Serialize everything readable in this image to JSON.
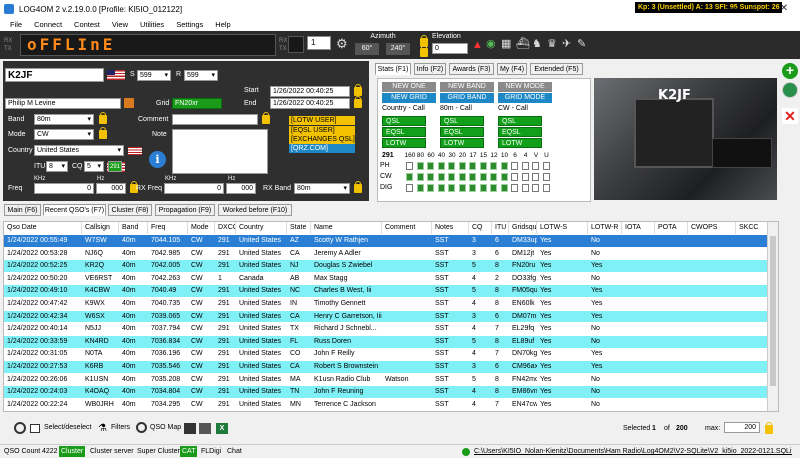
{
  "titlebar": {
    "title": "LOG4OM 2 v.2.19.0.0 [Profile: KI5IO_012122]",
    "kp": "Kp: 3 (Unsettled) A: 13 SFI: 95 Sunspot: 26",
    "min": "—",
    "max": "☐",
    "close": "✕"
  },
  "menu": [
    "File",
    "Connect",
    "Contest",
    "View",
    "Utilities",
    "Settings",
    "Help"
  ],
  "radio": {
    "display": "oFFLInE",
    "rx": "RX",
    "tx": "TX",
    "spin_value": "1",
    "azimuth_label": "Azimuth",
    "az_short": "60°",
    "az_long": "240°",
    "elevation_label": "Elevation",
    "elevation_value": "0"
  },
  "entry": {
    "callsign": "K2JF",
    "rst_s_label": "S",
    "rst_s": "599",
    "rst_r_label": "R",
    "rst_r": "599",
    "start_label": "Start",
    "start": "1/26/2022 00:40:25",
    "end_label": "End",
    "end": "1/26/2022 00:40:25",
    "name": "Philip M Levine",
    "grid_label": "Grid",
    "grid": "FN20xr",
    "band_label": "Band",
    "band": "80m",
    "mode_label": "Mode",
    "mode": "CW",
    "country_label": "Country",
    "country": "United States",
    "comment_label": "Comment",
    "note_label": "Note",
    "itu_label": "ITU",
    "itu": "8",
    "cq_label": "CQ",
    "cq": "5",
    "dxcc": "291",
    "khz1": "KHz",
    "hz1": "Hz",
    "khz2": "KHz",
    "hz2": "Hz",
    "freq_label": "Freq",
    "freq_khz": "0",
    "freq_hz": "000",
    "rxfreq_label": "RX Freq",
    "rxfreq_khz": "0",
    "rxfreq_hz": "000",
    "rxband_label": "RX Band",
    "rxband": "80m",
    "tags": [
      "[LOTW USER]",
      "[EQSL USER]",
      "[EXCHANGES QSL]",
      "[QRZ.COM]"
    ]
  },
  "stats_tabs": [
    "Stats (F1)",
    "Info (F2)",
    "Awards (F3)",
    "My (F4)",
    "Extended (F5)"
  ],
  "stats": {
    "new_one": "NEW ONE",
    "new_grid": "NEW GRID",
    "new_band": "NEW BAND",
    "grid_band": "GRID BAND",
    "new_mode": "NEW MODE",
    "grid_mode": "GRID MODE",
    "col1": "Country - Call",
    "col2": "80m - Call",
    "col3": "CW - Call",
    "qsl": "QSL",
    "eqsl": "EQSL",
    "lotw": "LOTW",
    "count": "291",
    "bands": [
      "160",
      "80",
      "60",
      "40",
      "30",
      "20",
      "17",
      "15",
      "12",
      "10",
      "6",
      "4",
      "V",
      "U"
    ],
    "rows": [
      "PH",
      "CW",
      "DIG"
    ]
  },
  "photo_callsign": "K2JF",
  "bottom_tabs": [
    "Main (F6)",
    "Recent QSO's (F7)",
    "Cluster (F8)",
    "Propagation (F9)",
    "Worked before (F10)"
  ],
  "grid_headers": [
    "Qso Date",
    "Callsign",
    "Band",
    "Freq",
    "Mode",
    "DXCC",
    "Country",
    "State",
    "Name",
    "Comment",
    "Notes",
    "CQ",
    "ITU",
    "Gridsquare",
    "LOTW-S",
    "LOTW-R",
    "IOTA",
    "POTA",
    "CWOPS",
    "SKCC"
  ],
  "qsos": [
    [
      "1/24/2022 00:55:49",
      "W7SW",
      "40m",
      "7044.105",
      "CW",
      "291",
      "United States",
      "AZ",
      "Scotty W Rathjen",
      "",
      "SST",
      "3",
      "6",
      "DM33up",
      "Yes",
      "No"
    ],
    [
      "1/24/2022 00:53:28",
      "NJ6Q",
      "40m",
      "7042.985",
      "CW",
      "291",
      "United States",
      "CA",
      "Jeremy A Adler",
      "",
      "SST",
      "3",
      "6",
      "DM12jt",
      "Yes",
      "No"
    ],
    [
      "1/24/2022 00:52:25",
      "KR2Q",
      "40m",
      "7042.005",
      "CW",
      "291",
      "United States",
      "NJ",
      "Douglas S Zwiebel",
      "",
      "SST",
      "5",
      "8",
      "FN20ru",
      "Yes",
      "Yes"
    ],
    [
      "1/24/2022 00:50:20",
      "VE6RST",
      "40m",
      "7042.263",
      "CW",
      "1",
      "Canada",
      "AB",
      "Max Stagg",
      "",
      "SST",
      "4",
      "2",
      "DO33fg",
      "Yes",
      "No"
    ],
    [
      "1/24/2022 00:49:10",
      "K4CBW",
      "40m",
      "7040.49",
      "CW",
      "291",
      "United States",
      "NC",
      "Charles B West, Iii",
      "",
      "SST",
      "5",
      "8",
      "FM05qu",
      "Yes",
      "Yes"
    ],
    [
      "1/24/2022 00:47:42",
      "K9WX",
      "40m",
      "7040.735",
      "CW",
      "291",
      "United States",
      "IN",
      "Timothy Gennett",
      "",
      "SST",
      "4",
      "8",
      "EN60lk",
      "Yes",
      "Yes"
    ],
    [
      "1/24/2022 00:42:34",
      "W6SX",
      "40m",
      "7039.065",
      "CW",
      "291",
      "United States",
      "CA",
      "Henry C Garretson, Iii",
      "",
      "SST",
      "3",
      "6",
      "DM07mp",
      "Yes",
      "Yes"
    ],
    [
      "1/24/2022 00:40:14",
      "N5JJ",
      "40m",
      "7037.794",
      "CW",
      "291",
      "United States",
      "TX",
      "Richard J Schnebl...",
      "",
      "SST",
      "4",
      "7",
      "EL29fq",
      "Yes",
      "No"
    ],
    [
      "1/24/2022 00:33:59",
      "KN4RD",
      "40m",
      "7036.834",
      "CW",
      "291",
      "United States",
      "FL",
      "Russ Doren",
      "",
      "SST",
      "5",
      "8",
      "EL89uf",
      "Yes",
      "No"
    ],
    [
      "1/24/2022 00:31:05",
      "N0TA",
      "40m",
      "7036.196",
      "CW",
      "291",
      "United States",
      "CO",
      "John F Reilly",
      "",
      "SST",
      "4",
      "7",
      "DN70kg",
      "Yes",
      "Yes"
    ],
    [
      "1/24/2022 00:27:53",
      "K6RB",
      "40m",
      "7035.546",
      "CW",
      "291",
      "United States",
      "CA",
      "Robert S Brownstein",
      "",
      "SST",
      "3",
      "6",
      "CM96ax",
      "Yes",
      "Yes"
    ],
    [
      "1/24/2022 00:26:06",
      "K1USN",
      "40m",
      "7035.208",
      "CW",
      "291",
      "United States",
      "MA",
      "K1usn Radio Club",
      "Watson",
      "SST",
      "5",
      "8",
      "FN42mc",
      "Yes",
      "No"
    ],
    [
      "1/24/2022 00:24:03",
      "K4OAQ",
      "40m",
      "7034.804",
      "CW",
      "291",
      "United States",
      "TN",
      "John F Reuning",
      "",
      "SST",
      "4",
      "8",
      "EM86vn",
      "Yes",
      "No"
    ],
    [
      "1/24/2022 00:22:24",
      "WB0JRH",
      "40m",
      "7034.295",
      "CW",
      "291",
      "United States",
      "MN",
      "Terrence C Jackson",
      "",
      "SST",
      "4",
      "7",
      "EN47cw",
      "Yes",
      "No"
    ]
  ],
  "bottombar": {
    "select": "Select/deselect",
    "filters": "Filters",
    "qso_map": "QSO Map",
    "selected_label": "Selected",
    "selected": "1",
    "of": "of",
    "total": "200",
    "max_label": "max:",
    "max": "200"
  },
  "statusbar": {
    "qso_count_label": "QSO Count",
    "qso_count": "4222",
    "cluster": "Cluster",
    "cluster_server": "Cluster server",
    "super_cluster": "Super Cluster",
    "cat": "CAT",
    "fldigi": "FLDigi",
    "chat": "Chat",
    "path": "C:\\Users\\KI5IO_Nolan-Kienitz\\Documents\\Ham Radio\\Log4OM2\\V2-SQLite\\V2_ki5io_2022-0121.SQLite"
  },
  "colors": {
    "accent": "#0078d7",
    "row_alt": "#80f0f7",
    "selected": "#2a7fd4",
    "green": "#12a01a",
    "gray_btn": "#8a8a8a",
    "blue_btn": "#1e88c7",
    "display": "#ff8a1a"
  }
}
